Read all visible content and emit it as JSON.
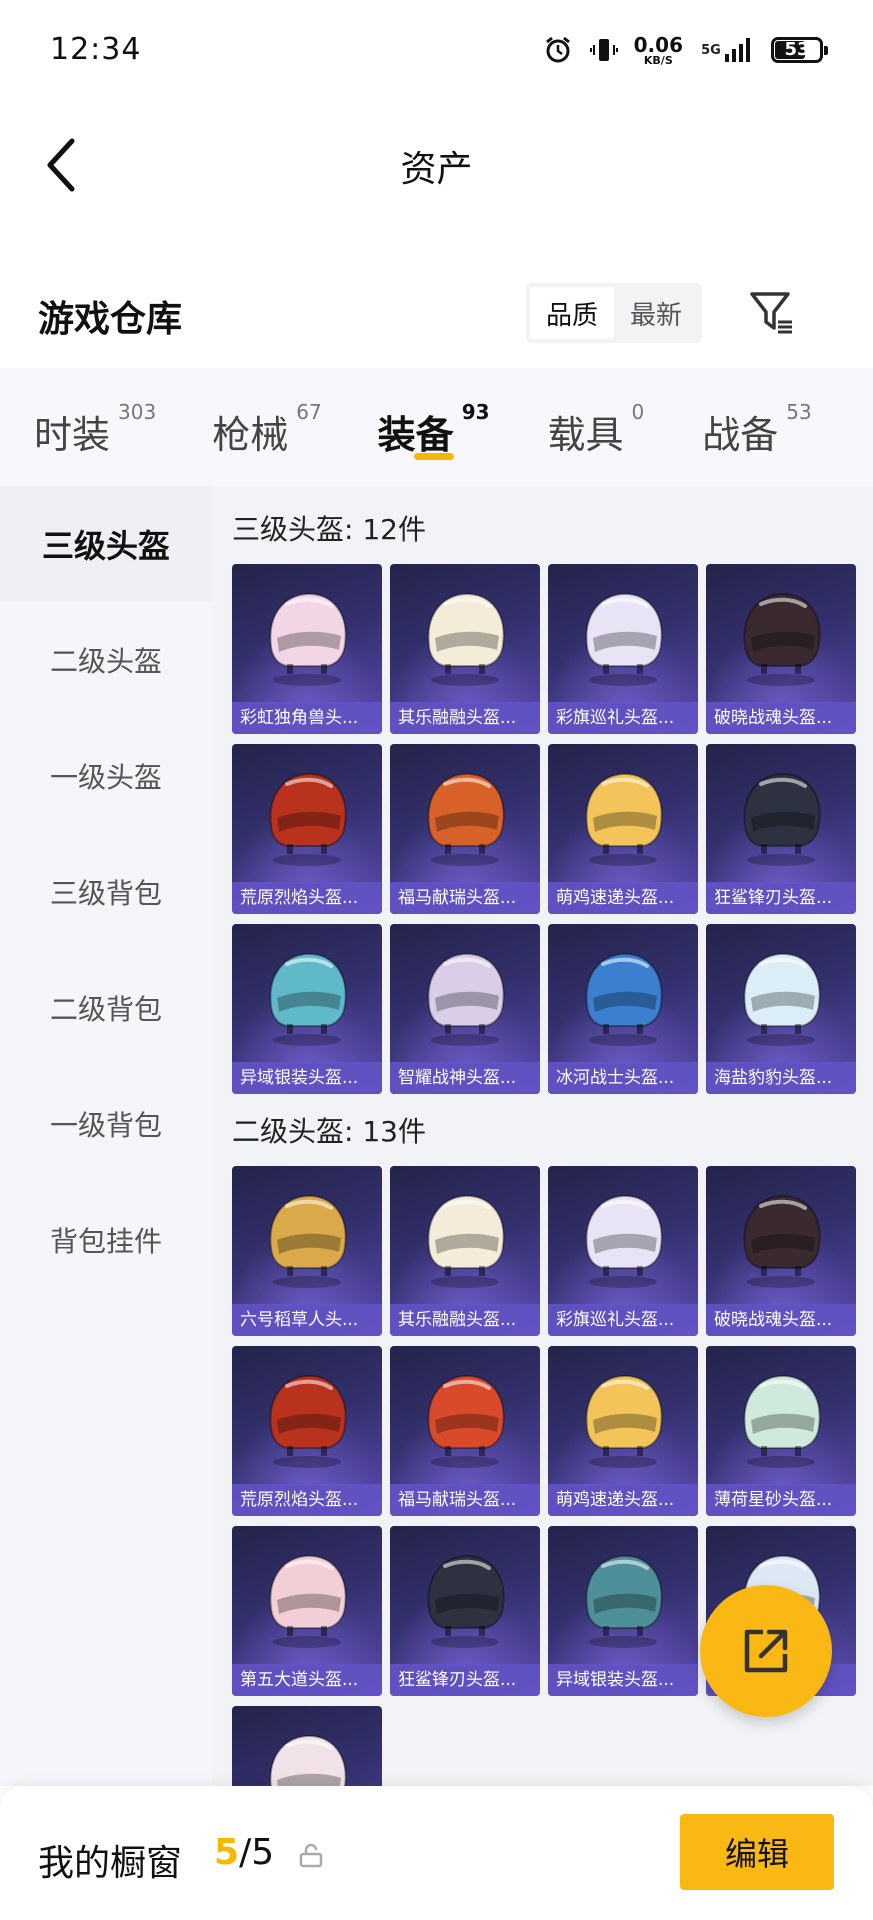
{
  "status_bar": {
    "time": "12:34",
    "net_speed": "0.06",
    "net_unit": "KB/S",
    "signal_type": "5G",
    "battery": "53"
  },
  "header": {
    "title": "资产"
  },
  "warehouse": {
    "title": "游戏仓库",
    "sort_options": [
      "品质",
      "最新"
    ],
    "sort_selected": "品质"
  },
  "tabs": [
    {
      "label": "时装",
      "count": "303"
    },
    {
      "label": "枪械",
      "count": "67"
    },
    {
      "label": "装备",
      "count": "93"
    },
    {
      "label": "载具",
      "count": "0"
    },
    {
      "label": "战备",
      "count": "53"
    }
  ],
  "active_tab": "装备",
  "sidenav": [
    "三级头盔",
    "二级头盔",
    "一级头盔",
    "三级背包",
    "二级背包",
    "一级背包",
    "背包挂件"
  ],
  "active_nav": "三级头盔",
  "sections": [
    {
      "title": "三级头盔: 12件",
      "items": [
        {
          "label": "彩虹独角兽头...",
          "color": "#f3d6e6"
        },
        {
          "label": "其乐融融头盔...",
          "color": "#f4ecd8"
        },
        {
          "label": "彩旗巡礼头盔...",
          "color": "#e8e4f5"
        },
        {
          "label": "破晓战魂头盔...",
          "color": "#3a2a30"
        },
        {
          "label": "荒原烈焰头盔...",
          "color": "#b8321e"
        },
        {
          "label": "福马献瑞头盔...",
          "color": "#d9622a"
        },
        {
          "label": "萌鸡速递头盔...",
          "color": "#f2c45a"
        },
        {
          "label": "狂鲨锋刃头盔...",
          "color": "#2e3140"
        },
        {
          "label": "异域银装头盔...",
          "color": "#5fb9c9"
        },
        {
          "label": "智耀战神头盔...",
          "color": "#d9cde8"
        },
        {
          "label": "冰河战士头盔...",
          "color": "#3a7fd0"
        },
        {
          "label": "海盐豹豹头盔...",
          "color": "#dbeef7"
        }
      ]
    },
    {
      "title": "二级头盔: 13件",
      "items": [
        {
          "label": "六号稻草人头...",
          "color": "#d9a94a"
        },
        {
          "label": "其乐融融头盔...",
          "color": "#f4ecd8"
        },
        {
          "label": "彩旗巡礼头盔...",
          "color": "#e8e4f5"
        },
        {
          "label": "破晓战魂头盔...",
          "color": "#3a2a30"
        },
        {
          "label": "荒原烈焰头盔...",
          "color": "#b8321e"
        },
        {
          "label": "福马献瑞头盔...",
          "color": "#d94a2a"
        },
        {
          "label": "萌鸡速递头盔...",
          "color": "#f2c45a"
        },
        {
          "label": "薄荷星砂头盔...",
          "color": "#cfe9dc"
        },
        {
          "label": "第五大道头盔...",
          "color": "#f2cfd6"
        },
        {
          "label": "狂鲨锋刃头盔...",
          "color": "#2e3140"
        },
        {
          "label": "异域银装头盔...",
          "color": "#4f8f99"
        },
        {
          "label": "...",
          "color": "#dde8f5"
        },
        {
          "label": "",
          "color": "#f0e2e8"
        }
      ]
    }
  ],
  "bottom_bar": {
    "label": "我的橱窗",
    "current": "5",
    "separator": "/",
    "total": "5",
    "edit_label": "编辑"
  },
  "colors": {
    "accent": "#f9b814",
    "card_bg": "#33306d",
    "card_label_bg": "#6455c8"
  }
}
